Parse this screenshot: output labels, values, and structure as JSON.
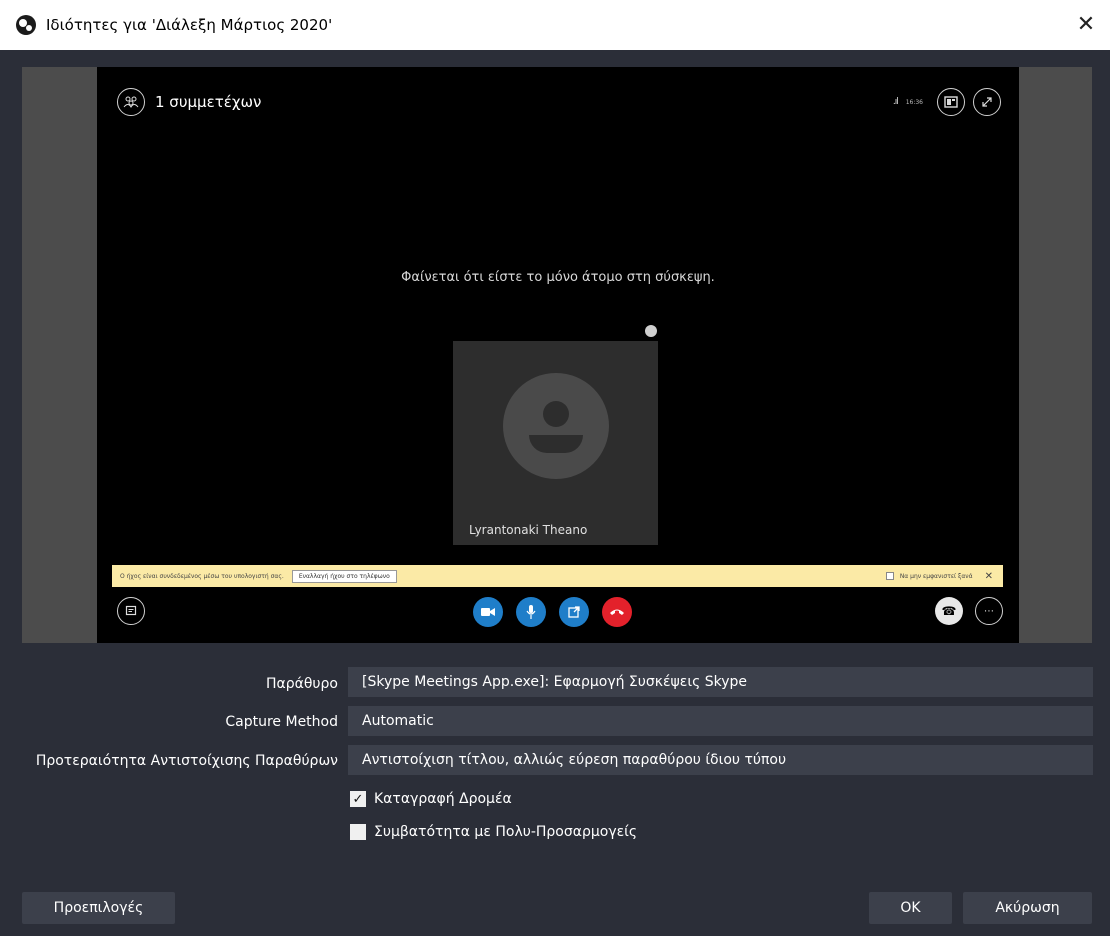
{
  "window": {
    "title": "Ιδιότητες για 'Διάλεξη Μάρτιος 2020'",
    "close_glyph": "✕"
  },
  "skype": {
    "participants_label": "1 συμμετέχων",
    "participants_icon": "people-icon",
    "signal_glyph": ".ıl",
    "clock": "16:36",
    "alone_message": "Φαίνεται ότι είστε το μόνο άτομο στη σύσκεψη.",
    "participant_name": "Lyrantonaki Theano",
    "banner": {
      "text": "Ο ήχος είναι συνδεδεμένος μέσω του υπολογιστή σας.",
      "button": "Εναλλαγή ήχου στο τηλέφωνο",
      "dont_show": "Να μην εμφανιστεί ξανά",
      "close_glyph": "✕"
    }
  },
  "form": {
    "window_label": "Παράθυρο",
    "window_value": "[Skype Meetings App.exe]: Εφαρμογή Συσκέψεις Skype",
    "capture_label": "Capture Method",
    "capture_value": "Automatic",
    "priority_label": "Προτεραιότητα Αντιστοίχισης Παραθύρων",
    "priority_value": "Αντιστοίχιση τίτλου, αλλιώς εύρεση παραθύρου ίδιου τύπου",
    "capture_cursor_label": "Καταγραφή Δρομέα",
    "capture_cursor_checked": true,
    "multi_adapter_label": "Συμβατότητα με Πολυ-Προσαρμογείς",
    "multi_adapter_checked": false
  },
  "buttons": {
    "defaults": "Προεπιλογές",
    "ok": "OK",
    "cancel": "Ακύρωση"
  },
  "colors": {
    "background": "#2b2e38",
    "field": "#3c404b",
    "preview_border": "#4c4c4c",
    "skype_blue": "#1f7ec9",
    "hangup_red": "#e3212b",
    "banner": "#fbeaa6"
  }
}
